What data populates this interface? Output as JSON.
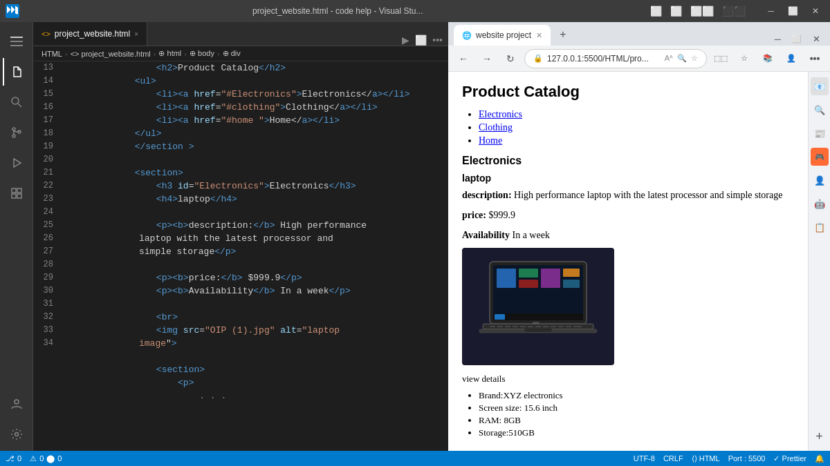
{
  "titlebar": {
    "logo": "VS",
    "title": "project_website.html - code help - Visual Stu...",
    "layout_icons": [
      "⬜",
      "⬜",
      "⬜⬜",
      "⬛⬛"
    ],
    "window_controls": [
      "─",
      "⬜",
      "✕"
    ]
  },
  "tabs": {
    "active_tab": "project_website.html",
    "close_icon": "×",
    "run_icon": "▶",
    "layout_icon": "⬜",
    "more_icon": "•••"
  },
  "breadcrumb": {
    "items": [
      "HTML",
      ">",
      "<> project_website.html",
      ">",
      "⊕ html",
      ">",
      "⊕ body",
      ">",
      "⊕ div"
    ]
  },
  "code_lines": [
    {
      "num": "13",
      "content": "                <h2>Product Catalog</h2>",
      "parts": [
        {
          "type": "indent",
          "text": "                "
        },
        {
          "type": "tag",
          "text": "<h2>"
        },
        {
          "type": "text",
          "text": "Product Catalog"
        },
        {
          "type": "tag",
          "text": "</h2>"
        }
      ]
    },
    {
      "num": "14",
      "content": "            <ul>",
      "parts": [
        {
          "type": "indent",
          "text": "            "
        },
        {
          "type": "tag",
          "text": "<ul>"
        }
      ]
    },
    {
      "num": "15",
      "content": "                <li><a href=\"#Electronics\">Electronics</a></li>",
      "parts": [
        {
          "type": "indent",
          "text": "                "
        },
        {
          "type": "tag",
          "text": "<li>"
        },
        {
          "type": "tag",
          "text": "<a "
        },
        {
          "type": "attr",
          "text": "href"
        },
        {
          "type": "text",
          "text": "="
        },
        {
          "type": "string",
          "text": "\"#Electronics\""
        },
        {
          "type": "tag",
          "text": ">"
        },
        {
          "type": "text",
          "text": "Electronics</"
        },
        {
          "type": "tag",
          "text": "a></li>"
        }
      ]
    },
    {
      "num": "16",
      "content": "                <li><a href=\"#clothing\">Clothing</a></li>",
      "parts": [
        {
          "type": "indent",
          "text": "                "
        },
        {
          "type": "tag",
          "text": "<li>"
        },
        {
          "type": "tag",
          "text": "<a "
        },
        {
          "type": "attr",
          "text": "href"
        },
        {
          "type": "text",
          "text": "="
        },
        {
          "type": "string",
          "text": "\"#clothing\""
        },
        {
          "type": "tag",
          "text": ">"
        },
        {
          "type": "text",
          "text": "Clothing</"
        },
        {
          "type": "tag",
          "text": "a></li>"
        }
      ]
    },
    {
      "num": "17",
      "content": "                <li><a href=\"#home \">Home</a></li>",
      "parts": [
        {
          "type": "indent",
          "text": "                "
        },
        {
          "type": "tag",
          "text": "<li>"
        },
        {
          "type": "tag",
          "text": "<a "
        },
        {
          "type": "attr",
          "text": "href"
        },
        {
          "type": "text",
          "text": "="
        },
        {
          "type": "string",
          "text": "\"#home \""
        },
        {
          "type": "tag",
          "text": ">"
        },
        {
          "type": "text",
          "text": "Home</"
        },
        {
          "type": "tag",
          "text": "a></li>"
        }
      ]
    },
    {
      "num": "18",
      "content": "            </ul>",
      "parts": [
        {
          "type": "indent",
          "text": "            "
        },
        {
          "type": "tag",
          "text": "</ul>"
        }
      ]
    },
    {
      "num": "19",
      "content": "            </section >",
      "parts": [
        {
          "type": "indent",
          "text": "            "
        },
        {
          "type": "tag",
          "text": "</section >"
        }
      ]
    },
    {
      "num": "20",
      "content": "",
      "parts": []
    },
    {
      "num": "21",
      "content": "            <section>",
      "parts": [
        {
          "type": "indent",
          "text": "            "
        },
        {
          "type": "tag",
          "text": "<section>"
        }
      ]
    },
    {
      "num": "22",
      "content": "                <h3 id=\"Electronics\">Electronics</h3>",
      "parts": [
        {
          "type": "indent",
          "text": "                "
        },
        {
          "type": "tag",
          "text": "<h3 "
        },
        {
          "type": "attr",
          "text": "id"
        },
        {
          "type": "text",
          "text": "="
        },
        {
          "type": "string",
          "text": "\"Electronics\""
        },
        {
          "type": "tag",
          "text": ">"
        },
        {
          "type": "text",
          "text": "Electronics"
        },
        {
          "type": "tag",
          "text": "</h3>"
        }
      ]
    },
    {
      "num": "23",
      "content": "                <h4>laptop</h4>",
      "parts": [
        {
          "type": "indent",
          "text": "                "
        },
        {
          "type": "tag",
          "text": "<h4>"
        },
        {
          "type": "text",
          "text": "laptop"
        },
        {
          "type": "tag",
          "text": "</h4>"
        }
      ]
    },
    {
      "num": "24",
      "content": "",
      "parts": []
    },
    {
      "num": "25",
      "content": "                <p><b>description:</b> High performance laptop with the latest processor and simple storage</p>",
      "parts": [
        {
          "type": "indent",
          "text": "                "
        },
        {
          "type": "tag",
          "text": "<p>"
        },
        {
          "type": "tag",
          "text": "<b>"
        },
        {
          "type": "text",
          "text": "description:"
        },
        {
          "type": "tag",
          "text": "</b>"
        },
        {
          "type": "text",
          "text": " High performance laptop with the latest processor and simple storage"
        },
        {
          "type": "tag",
          "text": "</p>"
        }
      ]
    },
    {
      "num": "26",
      "content": "",
      "parts": []
    },
    {
      "num": "27",
      "content": "                <p><b>price:</b> $999.9</p>",
      "parts": [
        {
          "type": "indent",
          "text": "                "
        },
        {
          "type": "tag",
          "text": "<p>"
        },
        {
          "type": "tag",
          "text": "<b>"
        },
        {
          "type": "text",
          "text": "price:"
        },
        {
          "type": "tag",
          "text": "</b>"
        },
        {
          "type": "text",
          "text": " $999.9"
        },
        {
          "type": "tag",
          "text": "</p>"
        }
      ]
    },
    {
      "num": "28",
      "content": "                <p><b>Availability</b> In a week</p>",
      "parts": [
        {
          "type": "indent",
          "text": "                "
        },
        {
          "type": "tag",
          "text": "<p>"
        },
        {
          "type": "tag",
          "text": "<b>"
        },
        {
          "type": "text",
          "text": "Availability"
        },
        {
          "type": "tag",
          "text": "</b>"
        },
        {
          "type": "text",
          "text": " In a week"
        },
        {
          "type": "tag",
          "text": "</p>"
        }
      ]
    },
    {
      "num": "29",
      "content": "",
      "parts": []
    },
    {
      "num": "30",
      "content": "                <br>",
      "parts": [
        {
          "type": "indent",
          "text": "                "
        },
        {
          "type": "tag",
          "text": "<br>"
        }
      ]
    },
    {
      "num": "31",
      "content": "                <img src=\"OIP (1).jpg\" alt=\"laptop image\">",
      "parts": [
        {
          "type": "indent",
          "text": "                "
        },
        {
          "type": "tag",
          "text": "<img "
        },
        {
          "type": "attr",
          "text": "src"
        },
        {
          "type": "text",
          "text": "="
        },
        {
          "type": "string",
          "text": "\"OIP (1).jpg\""
        },
        {
          "type": "text",
          "text": " "
        },
        {
          "type": "attr",
          "text": "alt"
        },
        {
          "type": "text",
          "text": "="
        },
        {
          "type": "string",
          "text": "\"laptop image\""
        },
        {
          "type": "tag",
          "text": ">"
        }
      ]
    },
    {
      "num": "32",
      "content": "",
      "parts": []
    },
    {
      "num": "33",
      "content": "                <section>",
      "parts": [
        {
          "type": "indent",
          "text": "                "
        },
        {
          "type": "tag",
          "text": "<section>"
        }
      ]
    },
    {
      "num": "34",
      "content": "                    <p>",
      "parts": [
        {
          "type": "indent",
          "text": "                    "
        },
        {
          "type": "tag",
          "text": "<p>"
        }
      ]
    }
  ],
  "statusbar": {
    "left": [
      "⎇ 0",
      "⚠ 0",
      "⬤ 0"
    ],
    "encoding": "UTF-8",
    "line_ending": "CRLF",
    "language": "HTML",
    "port": "Port : 5500",
    "prettier": "✓ Prettier",
    "bell": "🔔"
  },
  "browser": {
    "tab_title": "website project",
    "url": "127.0.0.1:5500/HTML/pro...",
    "content": {
      "page_title": "Product Catalog",
      "nav_links": [
        "Electronics",
        "Clothing",
        "Home"
      ],
      "section_title": "Electronics",
      "product_name": "laptop",
      "description_label": "description:",
      "description_text": "High performance laptop with the latest processor and simple storage",
      "price_label": "price:",
      "price_value": "$999.9",
      "availability_label": "Availability",
      "availability_text": "In a week",
      "view_details": "view details",
      "product_details": [
        "Brand:XYZ electronics",
        "Screen size: 15.6 inch",
        "RAM: 8GB",
        "Storage:510GB"
      ]
    }
  },
  "activity_icons": [
    "≡",
    "⚲",
    "⎇",
    "⬚",
    "⬚",
    "⧉"
  ],
  "activity_bottom_icons": [
    "☺",
    "⚙"
  ]
}
